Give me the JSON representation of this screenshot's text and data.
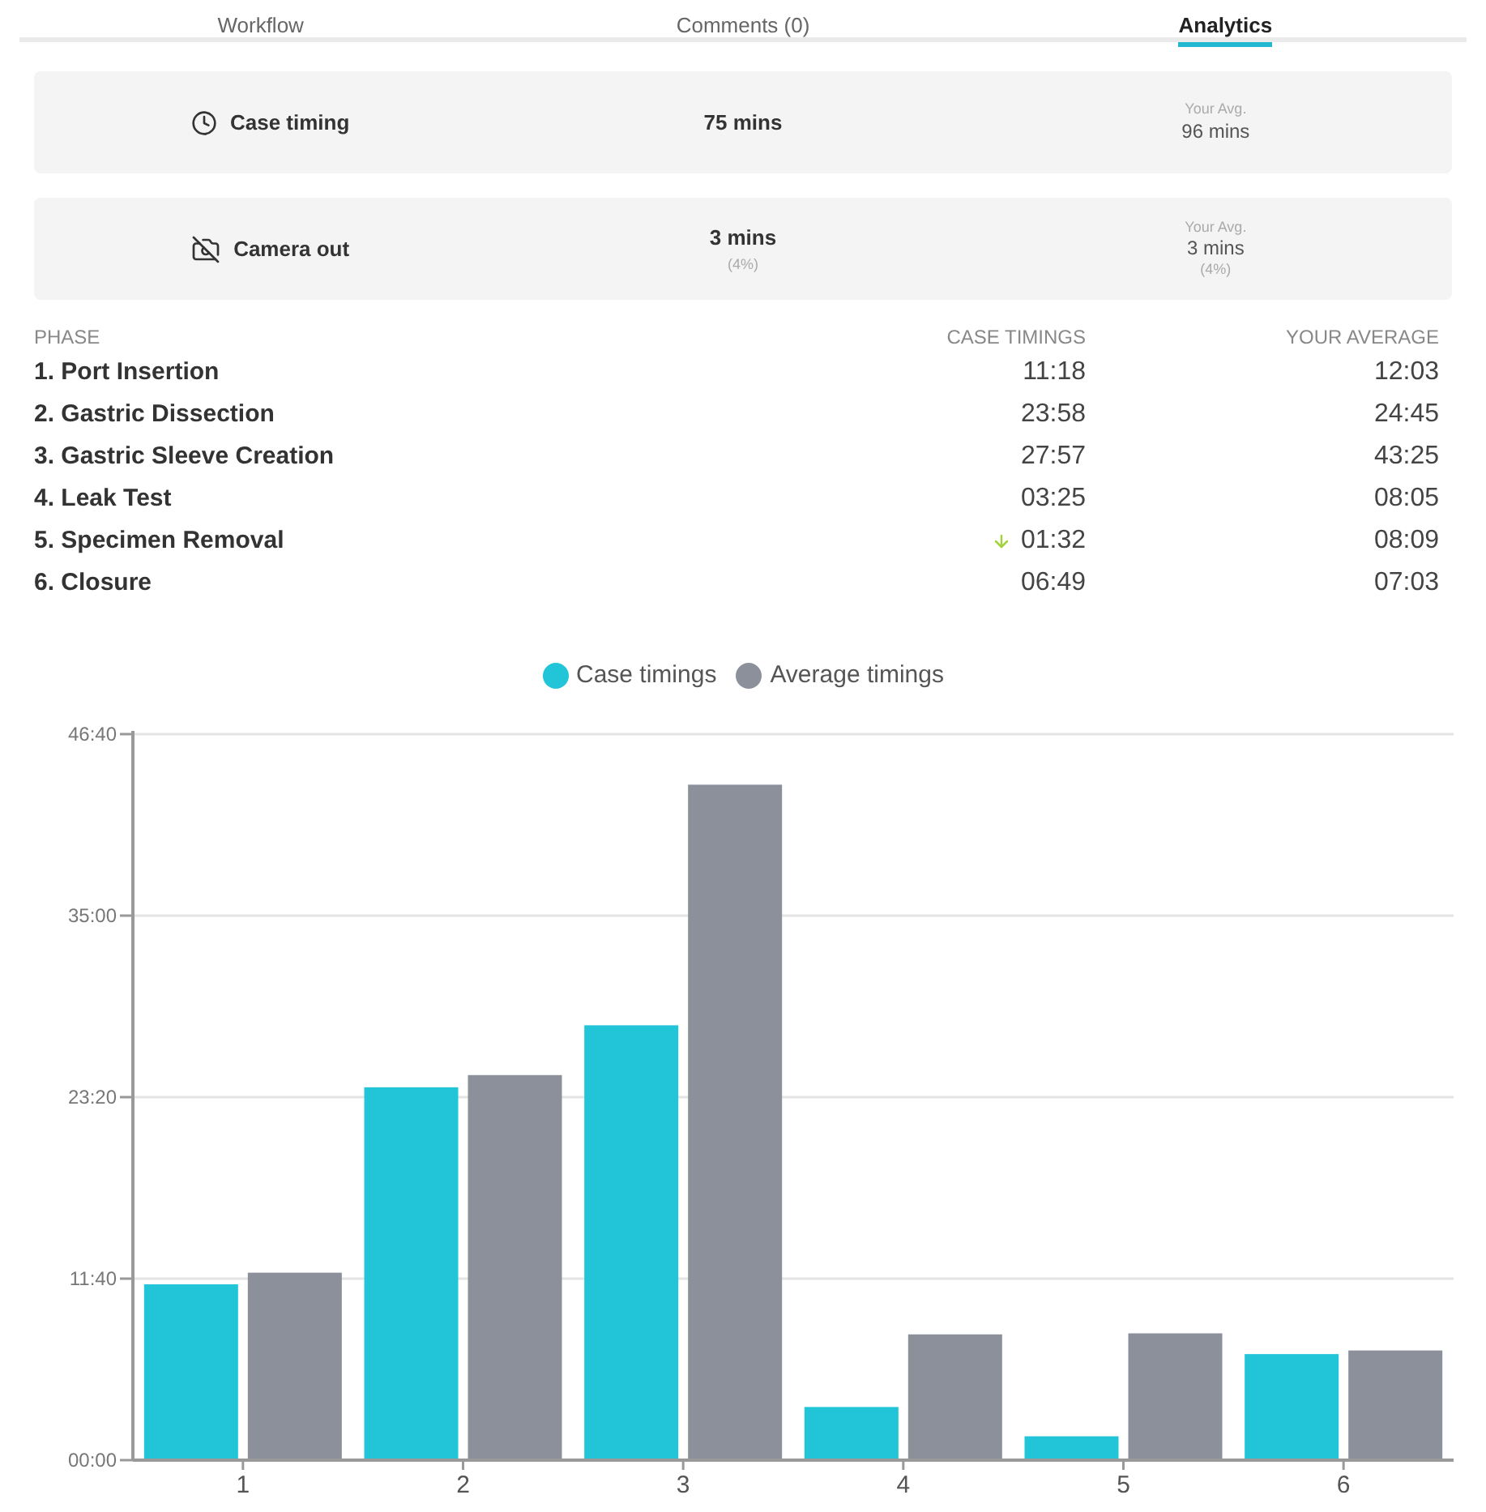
{
  "tabs": [
    {
      "label": "Workflow",
      "selected": false
    },
    {
      "label": "Comments (0)",
      "selected": false
    },
    {
      "label": "Analytics",
      "selected": true
    }
  ],
  "summary": [
    {
      "kind": "clock",
      "label": "Case timing",
      "value": "75 mins",
      "avg_label": "Your Avg.",
      "avg_value": "96 mins"
    },
    {
      "kind": "camera-off",
      "label": "Camera out",
      "value": "3 mins",
      "value_note": "(4%)",
      "avg_label": "Your Avg.",
      "avg_value": "3 mins",
      "avg_note": "(4%)"
    }
  ],
  "table": {
    "columns": [
      "PHASE",
      "CASE TIMINGS",
      "YOUR AVERAGE"
    ],
    "rows": [
      {
        "phase": "1. Port Insertion",
        "case": "11:18",
        "average": "12:03",
        "down": false
      },
      {
        "phase": "2. Gastric Dissection",
        "case": "23:58",
        "average": "24:45",
        "down": false
      },
      {
        "phase": "3. Gastric Sleeve Creation",
        "case": "27:57",
        "average": "43:25",
        "down": false
      },
      {
        "phase": "4. Leak Test",
        "case": "03:25",
        "average": "08:05",
        "down": false
      },
      {
        "phase": "5. Specimen Removal",
        "case": "01:32",
        "average": "08:09",
        "down": true
      },
      {
        "phase": "6. Closure",
        "case": "06:49",
        "average": "07:03",
        "down": false
      }
    ]
  },
  "chart_data": {
    "type": "bar",
    "grid": true,
    "categories": [
      "1",
      "2",
      "3",
      "4",
      "5",
      "6"
    ],
    "series": [
      {
        "name": "Case timings",
        "color": "#22c5d8",
        "values": [
          678,
          1438,
          1677,
          205,
          92,
          409
        ]
      },
      {
        "name": "Average timings",
        "color": "#8c909b",
        "values": [
          723,
          1485,
          2605,
          485,
          489,
          423
        ]
      }
    ],
    "ylim": [
      0,
      2800
    ],
    "yticks": [
      {
        "value": 0,
        "label": "00:00"
      },
      {
        "value": 700,
        "label": "11:40"
      },
      {
        "value": 1400,
        "label": "23:20"
      },
      {
        "value": 2100,
        "label": "35:00"
      },
      {
        "value": 2800,
        "label": "46:40"
      }
    ]
  }
}
